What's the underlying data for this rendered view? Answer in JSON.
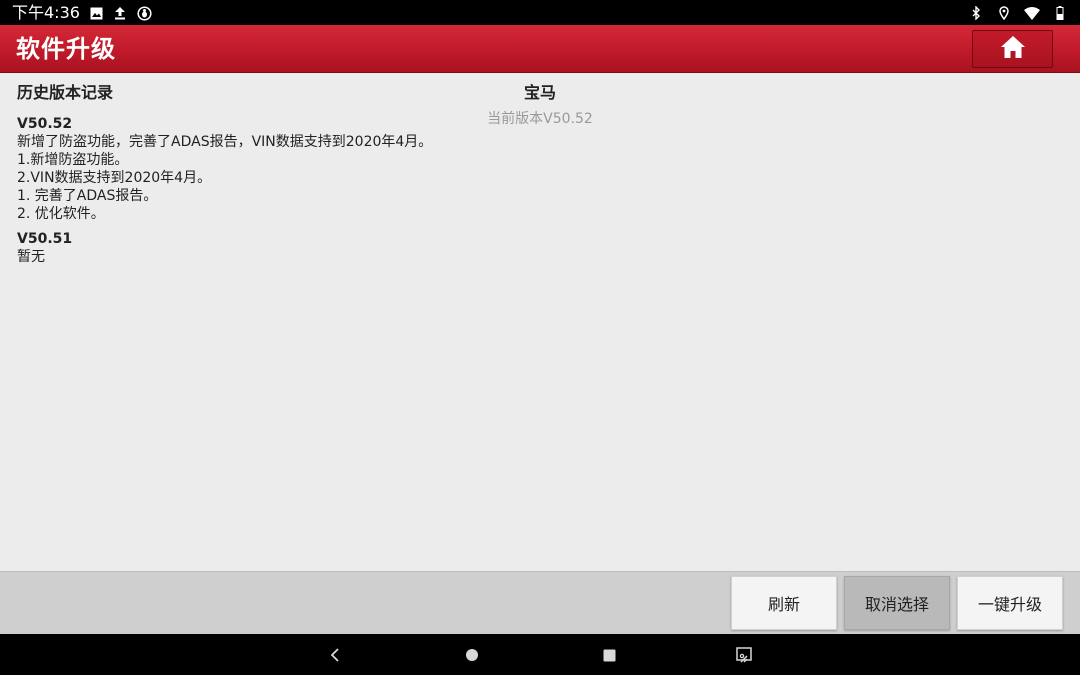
{
  "status_bar": {
    "time": "下午4:36",
    "left_icons": [
      "image-icon",
      "upload-icon",
      "debug-icon"
    ],
    "right_icons": [
      "bluetooth-icon",
      "location-icon",
      "wifi-icon",
      "battery-icon"
    ]
  },
  "header": {
    "title": "软件升级",
    "home_icon": "home-icon",
    "accent_color": "#c41a2b"
  },
  "main": {
    "history_heading": "历史版本记录",
    "brand_name": "宝马",
    "current_version": "当前版本V50.52",
    "versions": [
      {
        "number": "V50.52",
        "lines": [
          "新增了防盗功能，完善了ADAS报告，VIN数据支持到2020年4月。",
          "1.新增防盗功能。",
          "2.VIN数据支持到2020年4月。",
          "1. 完善了ADAS报告。",
          "2. 优化软件。"
        ]
      },
      {
        "number": "V50.51",
        "lines": [
          "暂无"
        ]
      }
    ]
  },
  "actions": {
    "refresh": "刷新",
    "cancel_selection": "取消选择",
    "one_click_upgrade": "一键升级"
  },
  "nav_bar": {
    "icons": [
      "back-icon",
      "home-circle-icon",
      "recents-icon",
      "screenshot-icon"
    ]
  }
}
